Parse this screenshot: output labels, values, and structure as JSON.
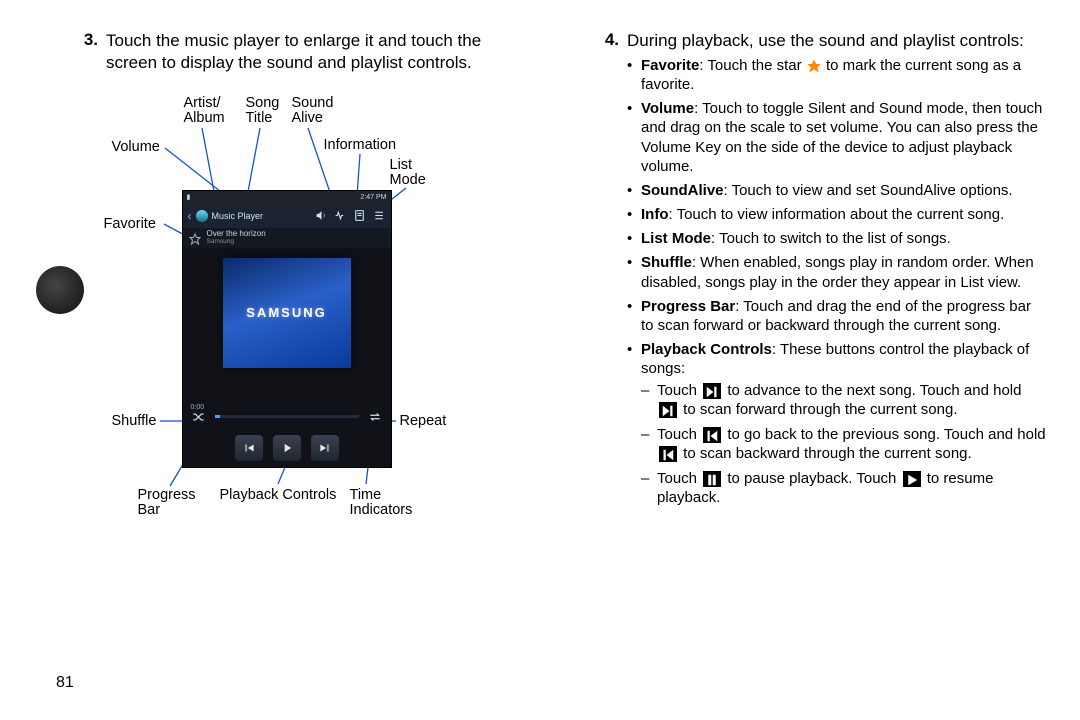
{
  "page_number": "81",
  "left": {
    "step_num": "3.",
    "step_text": "Touch the music player to enlarge it and touch the screen to display the sound and playlist controls."
  },
  "labels": {
    "volume": "Volume",
    "favorite": "Favorite",
    "shuffle": "Shuffle",
    "progress_bar": "Progress\nBar",
    "artist_album": "Artist/\nAlbum",
    "song_title": "Song\nTitle",
    "sound_alive": "Sound\nAlive",
    "information": "Information",
    "list_mode": "List\nMode",
    "repeat": "Repeat",
    "playback_controls": "Playback Controls",
    "time_indicators": "Time\nIndicators"
  },
  "shot": {
    "app_title": "Music Player",
    "song_title": "Over the horizon",
    "song_sub": "Samsung",
    "album_logo": "SAMSUNG",
    "time_a": "0:00",
    "time_b": "",
    "status_time": "2:47 PM"
  },
  "right": {
    "step_num": "4.",
    "step_text": "During playback, use the sound and playlist controls:",
    "bullets": [
      {
        "b": "Favorite",
        "t": ": Touch the star ",
        "t2": " to mark the current song as a favorite."
      },
      {
        "b": "Volume",
        "t": ": Touch to toggle Silent and Sound mode, then touch and drag on the scale to set volume. You can also press the Volume Key on the side of the device to adjust playback volume."
      },
      {
        "b": "SoundAlive",
        "t": ": Touch to view and set SoundAlive options."
      },
      {
        "b": "Info",
        "t": ": Touch to view information about the current song."
      },
      {
        "b": "List Mode",
        "t": ": Touch to switch to the list of songs."
      },
      {
        "b": "Shuffle",
        "t": ": When enabled, songs play in random order. When disabled, songs play in the order they appear in List view."
      },
      {
        "b": "Progress Bar",
        "t": ": Touch and drag the end of the progress bar to scan forward or backward through the current song."
      },
      {
        "b": "Playback Controls",
        "t": ": These buttons control the playback of songs:"
      }
    ],
    "dashes": {
      "next_a": "Touch ",
      "next_b": " to advance to the next song. Touch and hold ",
      "next_c": " to scan forward through the current song.",
      "prev_a": "Touch ",
      "prev_b": " to go back to the previous song. Touch and hold ",
      "prev_c": " to scan backward through the current song.",
      "pause_a": "Touch ",
      "pause_b": " to pause playback. Touch ",
      "pause_c": " to resume playback."
    }
  }
}
